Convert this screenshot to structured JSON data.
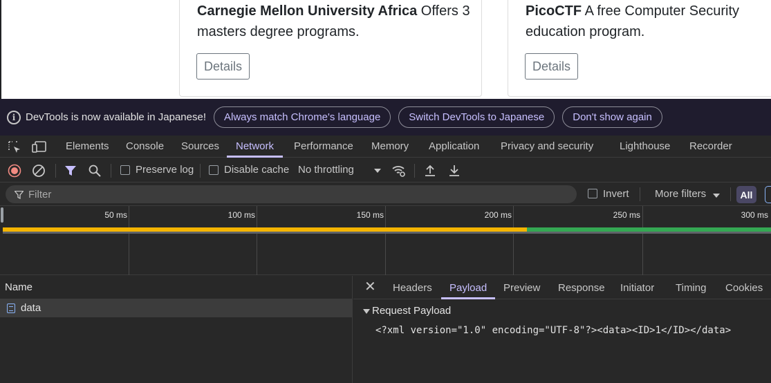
{
  "page": {
    "cards": [
      {
        "org": "Carnegie Mellon University Africa",
        "desc": " Offers 3 masters degree programs.",
        "button": "Details"
      },
      {
        "org": "PicoCTF",
        "desc": " A free Computer Security education program.",
        "button": "Details"
      }
    ]
  },
  "infobar": {
    "message": "DevTools is now available in Japanese!",
    "buttons": [
      "Always match Chrome's language",
      "Switch DevTools to Japanese",
      "Don't show again"
    ]
  },
  "tabs": [
    "Elements",
    "Console",
    "Sources",
    "Network",
    "Performance",
    "Memory",
    "Application",
    "Privacy and security",
    "Lighthouse",
    "Recorder"
  ],
  "active_tab": "Network",
  "toolbar": {
    "preserve_log": "Preserve log",
    "disable_cache": "Disable cache",
    "throttling": "No throttling"
  },
  "filterbar": {
    "placeholder": "Filter",
    "invert": "Invert",
    "more_filters": "More filters",
    "all": "All"
  },
  "timeline": {
    "ticks": [
      "50 ms",
      "100 ms",
      "150 ms",
      "200 ms",
      "250 ms",
      "300 ms"
    ]
  },
  "requests": {
    "header": "Name",
    "rows": [
      "data"
    ]
  },
  "details": {
    "tabs": [
      "Headers",
      "Payload",
      "Preview",
      "Response",
      "Initiator",
      "Timing",
      "Cookies"
    ],
    "active": "Payload",
    "section": "Request Payload",
    "payload": "<?xml version=\"1.0\" encoding=\"UTF-8\"?><data><ID>1</ID></data>"
  },
  "colors": {
    "accent": "#c7bfff",
    "waterfall_waiting": "#f4b400",
    "waterfall_download": "#34a853"
  }
}
